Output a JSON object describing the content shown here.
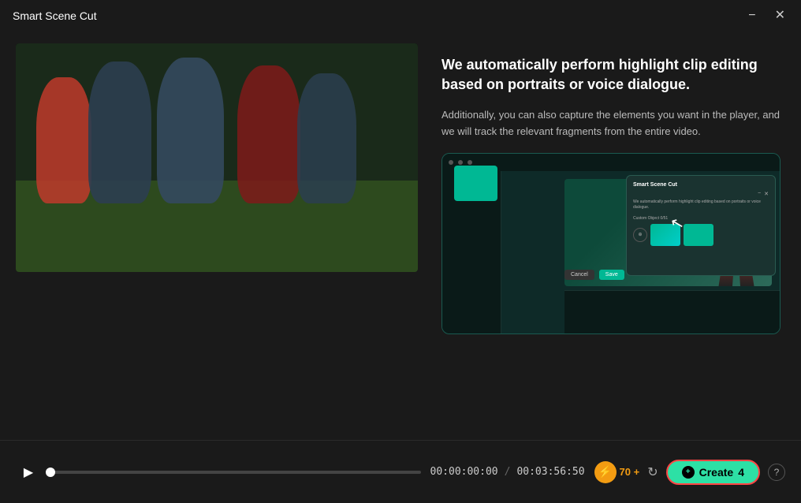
{
  "app": {
    "title": "Smart Scene Cut",
    "min_label": "−",
    "close_label": "✕"
  },
  "info": {
    "title": "We automatically perform highlight clip editing based on portraits or voice dialogue.",
    "description": "Additionally, you can also capture the elements you want in the player, and we will track the relevant fragments from the entire video."
  },
  "preview": {
    "dialog_title": "Smart Scene Cut",
    "dialog_text": "We automatically perform highlight clip editing based on portraits or voice dialogue.",
    "dialog_label": "Custom Object  0/51",
    "cancel_label": "Cancel",
    "save_label": "Save"
  },
  "controls": {
    "current_time": "00:00:00:00",
    "separator": "/",
    "total_time": "00:03:56:50",
    "ai_count": "70 +",
    "create_label": "Create",
    "create_count": "4",
    "help_label": "?"
  }
}
